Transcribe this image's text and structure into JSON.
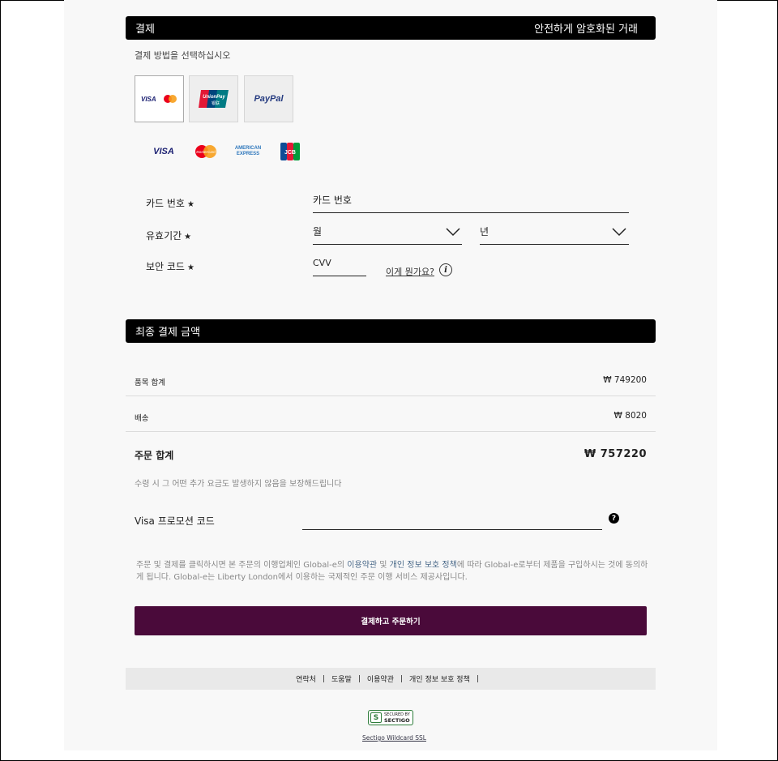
{
  "payment_header": {
    "title": "결제",
    "secure_label": "안전하게 암호화된 거래"
  },
  "payment_method_prompt": "결제 방법을 선택하십시오",
  "payment_methods": [
    {
      "name": "Visa / MasterCard",
      "label_visa": "VISA",
      "label_mc": "MasterCard",
      "selected": true
    },
    {
      "name": "UnionPay",
      "label": "UnionPay",
      "sublabel": "银联"
    },
    {
      "name": "PayPal",
      "label": "PayPal"
    }
  ],
  "accepted_brands": [
    {
      "name": "VISA"
    },
    {
      "name": "MasterCard"
    },
    {
      "name": "AMERICAN EXPRESS",
      "line1": "AMERICAN",
      "line2": "EXPRESS"
    },
    {
      "name": "JCB"
    }
  ],
  "form": {
    "card_number": {
      "label": "카드 번호",
      "placeholder": "카드 번호"
    },
    "expiry": {
      "label": "유효기간",
      "month_placeholder": "월",
      "year_placeholder": "년"
    },
    "security_code": {
      "label": "보안 코드",
      "placeholder": "CVV",
      "help_link": "이게 뭔가요?"
    },
    "required_mark": "★"
  },
  "summary_header": {
    "title": "최종 결제 금액"
  },
  "summary": {
    "items_total": {
      "label": "품목 합계",
      "value": "₩ 749200"
    },
    "shipping": {
      "label": "배송",
      "value": "₩ 8020"
    },
    "order_total": {
      "label": "주문 합계",
      "value": "₩ 757220"
    },
    "guarantee_note": "수령 시 그 어떤 추가 요금도 발생하지 않음을 보장해드립니다"
  },
  "promo": {
    "label": "Visa 프로모션 코드",
    "help_icon": "question-icon"
  },
  "legal": {
    "part1": "주문 및 결제를 클릭하시면 본 주문의 이행업체인 Global-e의 ",
    "terms_link": "이용약관",
    "part2": " 및 ",
    "privacy_link": "개인 정보 보호 정책",
    "part3": "에 따라 Global-e로부터 제품을 구입하시는 것에 동의하게 됩니다. Global-e는 Liberty London에서 이용하는 국제적인 주문 이행 서비스 제공사입니다."
  },
  "pay_button": "결제하고 주문하기",
  "footer_links": [
    "연락처",
    "도움말",
    "이용약관",
    "개인 정보 보호 정책"
  ],
  "footer_separator": "|",
  "ssl": {
    "badge_small": "SECURED BY",
    "badge_big": "SECTIGO",
    "badge_s": "S",
    "link": "Sectigo Wildcard SSL"
  },
  "colors": {
    "header_bar": "#000000",
    "pay_button": "#4a0a3a",
    "link": "#4b6a8a",
    "ssl_green": "#2e7d3b"
  }
}
